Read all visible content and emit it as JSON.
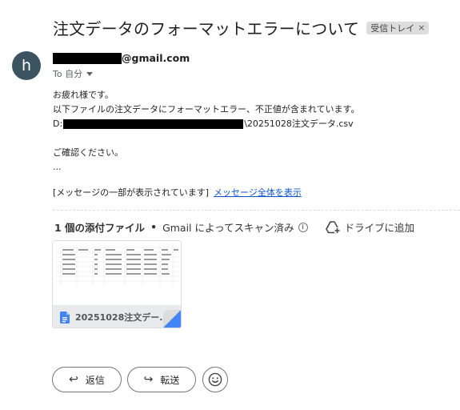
{
  "email": {
    "subject": "注文データのフォーマットエラーについて",
    "label": "受信トレイ",
    "label_close": "×",
    "avatar_letter": "h",
    "sender_domain": "@gmail.com",
    "recipient": "To 自分"
  },
  "body": {
    "line1": "お疲れ様です。",
    "line2": "以下ファイルの注文データにフォーマットエラー、不正値が含まれています。",
    "path_prefix": "D:",
    "path_suffix": "\\20251028注文データ.csv",
    "line4": "ご確認ください。",
    "ellipsis": "..."
  },
  "clipped": {
    "notice": "[メッセージの一部が表示されています]",
    "link": "メッセージ全体を表示"
  },
  "attachments": {
    "count_label": "1 個の添付ファイル",
    "separator": "•",
    "scan_text": "Gmail によってスキャン済み",
    "info_glyph": "i",
    "drive_button": "ドライブに追加",
    "file_name": "20251028注文デー..."
  },
  "actions": {
    "reply": "返信",
    "forward": "転送"
  },
  "colors": {
    "avatar": "#3c5461",
    "link": "#1155cc",
    "sheet_icon": "#4285f4"
  }
}
